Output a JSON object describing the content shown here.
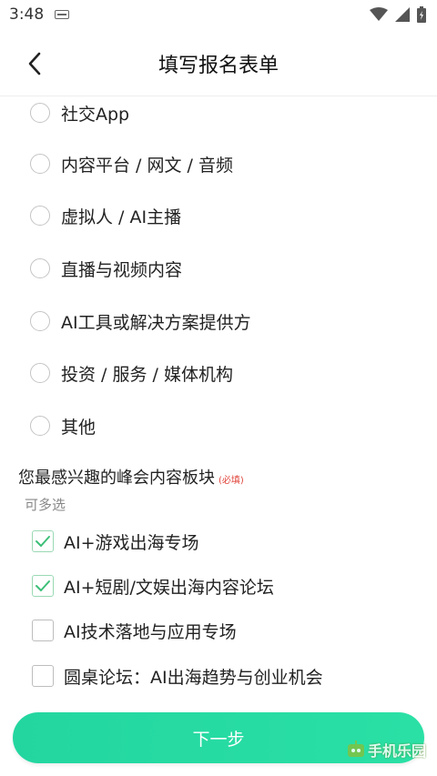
{
  "status_bar": {
    "time": "3:48"
  },
  "header": {
    "title": "填写报名表单"
  },
  "radio_options": [
    {
      "label": "社交App"
    },
    {
      "label": "内容平台 / 网文 / 音频"
    },
    {
      "label": "虚拟人 / AI主播"
    },
    {
      "label": "直播与视频内容"
    },
    {
      "label": "AI工具或解决方案提供方"
    },
    {
      "label": "投资 / 服务 / 媒体机构"
    },
    {
      "label": "其他"
    }
  ],
  "question": {
    "title": "您最感兴趣的峰会内容板块",
    "required": "(必填)",
    "hint": "可多选"
  },
  "checkbox_options": [
    {
      "label": "AI+游戏出海专场",
      "checked": true
    },
    {
      "label": "AI+短剧/文娱出海内容论坛",
      "checked": true
    },
    {
      "label": "AI技术落地与应用专场",
      "checked": false
    },
    {
      "label": "圆桌论坛：AI出海趋势与创业机会",
      "checked": false
    }
  ],
  "footer": {
    "next_label": "下一步"
  },
  "watermark": {
    "text": "手机乐园"
  },
  "colors": {
    "accent": "#2ad9a2",
    "check": "#3cbf77",
    "required": "#e0443a"
  }
}
